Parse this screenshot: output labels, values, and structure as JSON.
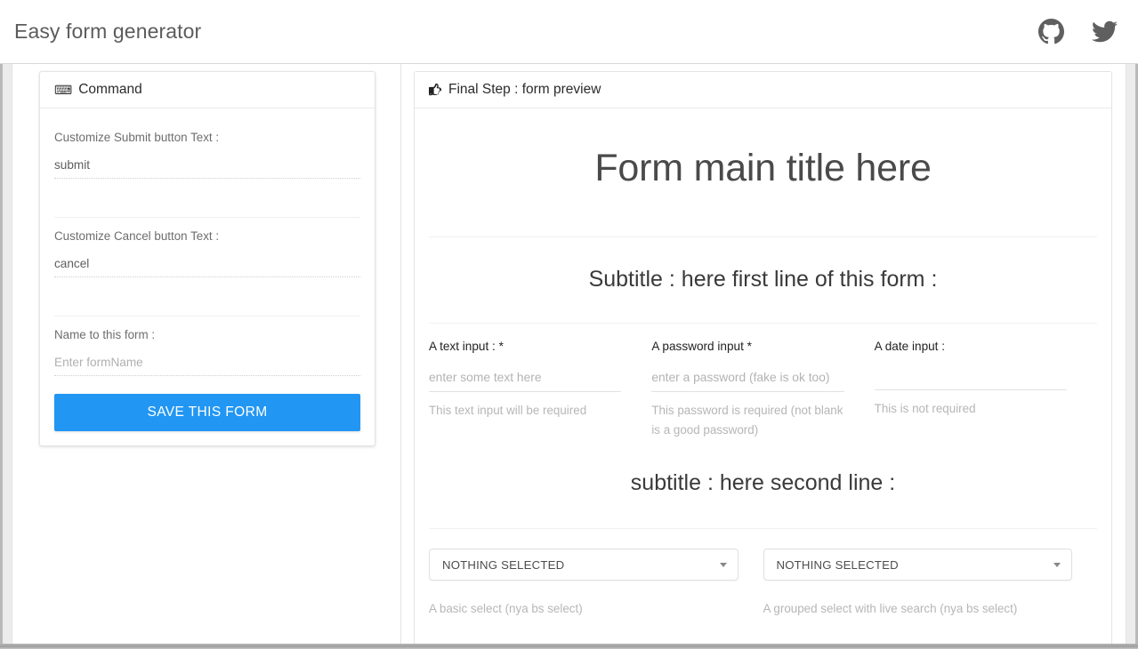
{
  "navbar": {
    "brand": "Easy form generator",
    "icons": [
      {
        "name": "github-icon",
        "label": "GitHub"
      },
      {
        "name": "twitter-icon",
        "label": "Twitter"
      }
    ]
  },
  "command_panel": {
    "header_icon": "keyboard-icon",
    "header_glyph": "⌨",
    "title": "Command",
    "fields": [
      {
        "label": "Customize Submit button Text :",
        "value": "submit",
        "placeholder": "submit",
        "is_placeholder": false
      },
      {
        "label": "Customize Cancel button Text :",
        "value": "cancel",
        "placeholder": "cancel",
        "is_placeholder": false
      },
      {
        "label": "Name to this form :",
        "value": "Enter formName",
        "placeholder": "Enter formName",
        "is_placeholder": true
      }
    ],
    "save_button": "SAVE THIS FORM",
    "save_button_color": "#2196f3"
  },
  "preview_panel": {
    "header_icon": "thumbs-up-icon",
    "title": "Final Step : form preview",
    "form": {
      "main_title": "Form main title here",
      "subtitle_first": "Subtitle : here first line of this form :",
      "subtitle_second": "subtitle : here second line :",
      "inputs": [
        {
          "label": "A text input : *",
          "placeholder": "enter some text here",
          "help": "This text input will be required"
        },
        {
          "label": "A password input *",
          "placeholder": "enter a password (fake is ok too)",
          "help": "This password is required (not blank is a good password)"
        },
        {
          "label": "A date input :",
          "placeholder": "",
          "help": "This is not required"
        }
      ],
      "selects": [
        {
          "value": "NOTHING SELECTED",
          "help": "A basic select (nya bs select)",
          "caret": "chevron-down-icon"
        },
        {
          "value": "NOTHING SELECTED",
          "help": "A grouped select with live search (nya bs select)",
          "caret": "chevron-down-icon"
        }
      ]
    }
  }
}
